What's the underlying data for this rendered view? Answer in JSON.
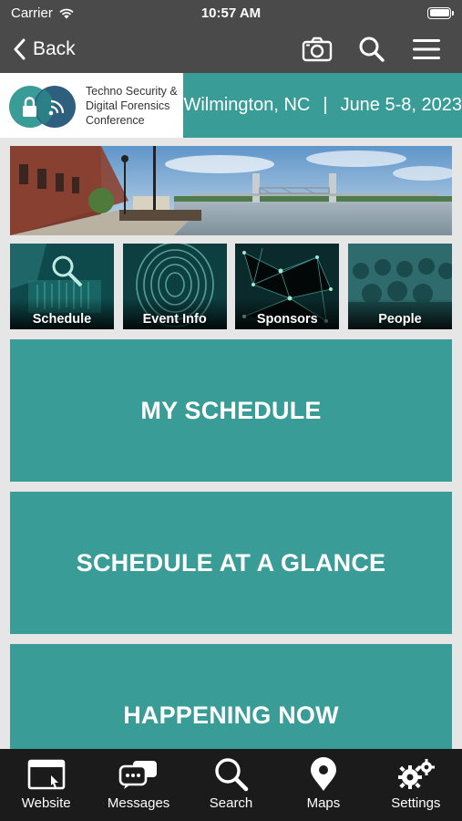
{
  "status_bar": {
    "carrier": "Carrier",
    "time": "10:57 AM"
  },
  "nav": {
    "back_label": "Back",
    "icons": [
      "camera-icon",
      "search-icon",
      "menu-icon"
    ]
  },
  "banner": {
    "logo_text_line1": "Techno Security &",
    "logo_text_line2": "Digital Forensics",
    "logo_text_line3": "Conference",
    "location": "Wilmington, NC",
    "separator": "|",
    "dates": "June 5-8, 2023"
  },
  "tiles": [
    {
      "label": "Schedule"
    },
    {
      "label": "Event Info"
    },
    {
      "label": "Sponsors"
    },
    {
      "label": "People"
    }
  ],
  "buttons": {
    "my_schedule": "MY SCHEDULE",
    "schedule_glance": "SCHEDULE AT A GLANCE",
    "happening_now": "HAPPENING NOW"
  },
  "tab_bar": [
    {
      "label": "Website",
      "icon": "browser-window-icon"
    },
    {
      "label": "Messages",
      "icon": "chat-bubbles-icon"
    },
    {
      "label": "Search",
      "icon": "search-icon"
    },
    {
      "label": "Maps",
      "icon": "map-pin-icon"
    },
    {
      "label": "Settings",
      "icon": "gears-icon"
    }
  ],
  "colors": {
    "accent": "#3a9c96",
    "nav_bg": "#4a4a4a",
    "tab_bg": "#1b1b1b",
    "page_bg": "#e6e6e6"
  }
}
